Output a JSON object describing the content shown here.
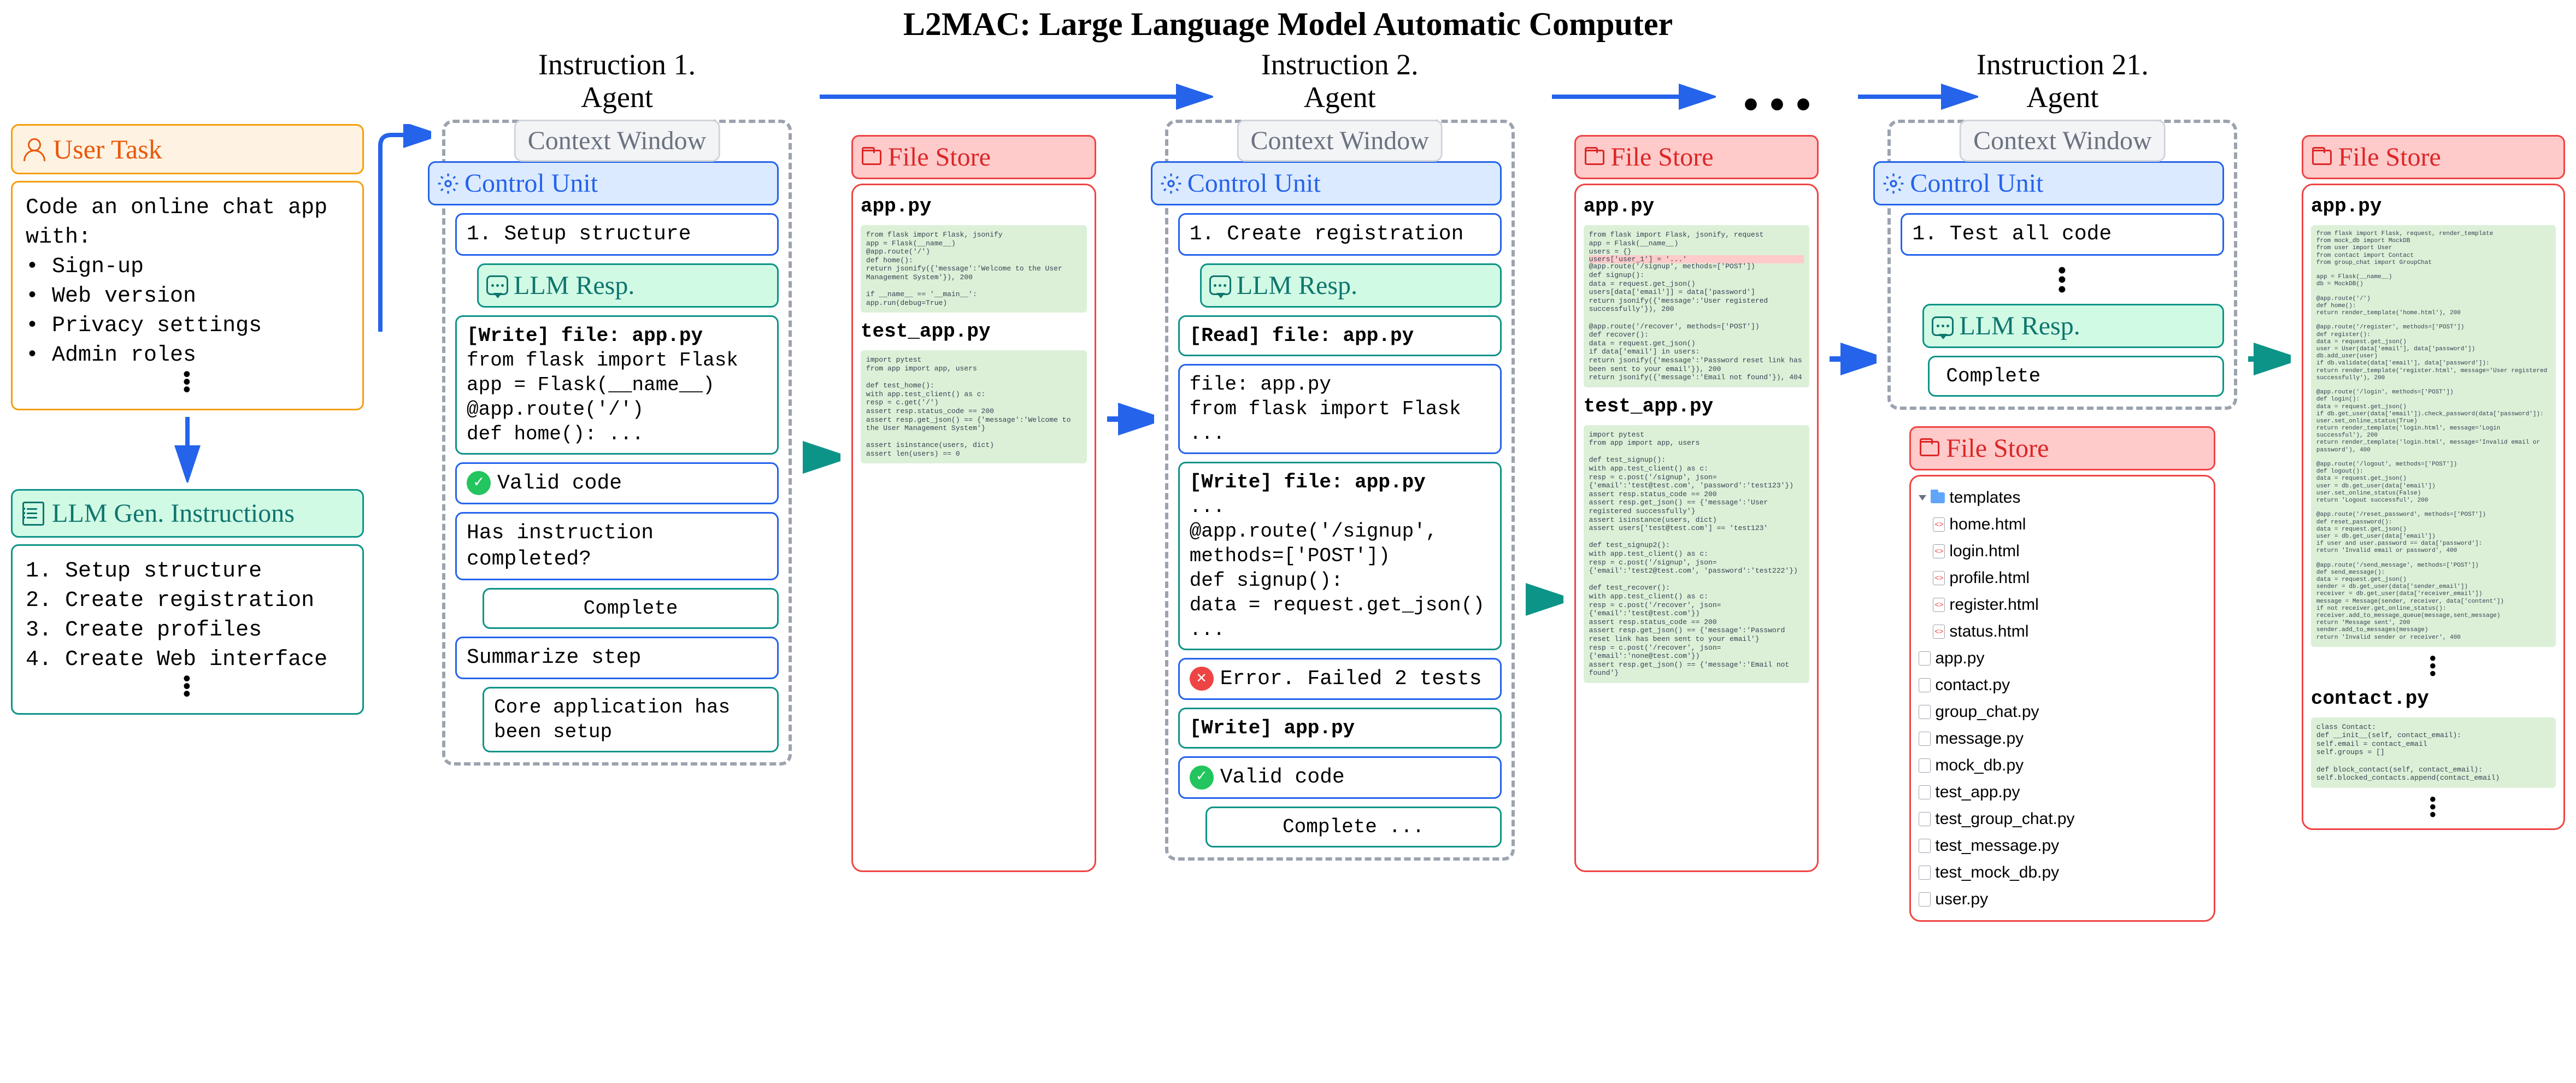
{
  "title": "L2MAC: Large Language Model Automatic Computer",
  "user_task": {
    "header": "User Task",
    "intro": "Code an online chat app with:",
    "bullets": [
      "Sign-up",
      "Web version",
      "Privacy settings",
      "Admin roles"
    ]
  },
  "llm_gen": {
    "header": "LLM Gen. Instructions",
    "items": [
      "1. Setup structure",
      "2. Create registration",
      "3. Create profiles",
      "4. Create Web interface"
    ]
  },
  "labels": {
    "context_window": "Context Window",
    "control_unit": "Control Unit",
    "llm_resp": "LLM Resp.",
    "file_store": "File Store",
    "agent": "Agent"
  },
  "instr1": {
    "title": "Instruction 1.",
    "cu_step": "1. Setup structure",
    "write_header": "[Write] file: app.py",
    "write_body": "from flask import Flask\napp = Flask(__name__)\n@app.route('/')\ndef home(): ...",
    "valid": "Valid code",
    "ask": "Has instruction completed?",
    "complete": "Complete",
    "summarize": "Summarize step",
    "summary": "Core application has been setup",
    "files": {
      "f1": "app.py",
      "c1": "from flask import Flask, jsonify\napp = Flask(__name__)\n@app.route('/')\ndef home():\n    return jsonify({'message':'Welcome to the User Management System'}), 200\n\nif __name__ == '__main__':\n    app.run(debug=True)",
      "f2": "test_app.py",
      "c2": "import pytest\nfrom app import app, users\n\ndef test_home():\n    with app.test_client() as c:\n        resp = c.get('/')\n        assert resp.status_code == 200\n        assert resp.get_json() == {'message':'Welcome to the User Management System'}\n\n    assert isinstance(users, dict)\n    assert len(users) == 0"
    }
  },
  "instr2": {
    "title": "Instruction 2.",
    "cu_step": "1. Create registration",
    "read_header": "[Read] file: app.py",
    "file_echo": "file: app.py\nfrom flask import Flask ...",
    "write_header": "[Write] file: app.py",
    "write_body": "...\n@app.route('/signup', methods=['POST'])\ndef signup():\n    data = request.get_json()\n...",
    "error": "Error. Failed 2 tests",
    "write2": "[Write] app.py",
    "valid": "Valid code",
    "complete": "Complete ...",
    "files": {
      "f1": "app.py",
      "c1_pre": "from flask import Flask, jsonify, request\napp = Flask(__name__)\nusers = {}",
      "c1_diff": "users['user_1'] = '...'",
      "c1_post": "@app.route('/signup', methods=['POST'])\ndef signup():\n    data = request.get_json()\n    users[data['email']] = data['password']\n    return jsonify({'message':'User registered successfully'}), 200\n\n@app.route('/recover', methods=['POST'])\ndef recover():\n    data = request.get_json()\n    if data['email'] in users:\n        return jsonify({'message':'Password reset link has been sent to your email'}), 200\n    return jsonify({'message':'Email not found'}), 404",
      "f2": "test_app.py",
      "c2": "import pytest\nfrom app import app, users\n\ndef test_signup():\n    with app.test_client() as c:\n        resp = c.post('/signup', json={'email':'test@test.com', 'password':'test123'})\n        assert resp.status_code == 200\n        assert resp.get_json() == {'message':'User registered successfully'}\n    assert isinstance(users, dict)\n    assert users['test@test.com'] == 'test123'\n\ndef test_signup2():\n    with app.test_client() as c:\n        resp = c.post('/signup', json={'email':'test2@test.com', 'password':'test222'})\n\ndef test_recover():\n    with app.test_client() as c:\n        resp = c.post('/recover', json={'email':'test@test.com'})\n        assert resp.status_code == 200\n        assert resp.get_json() == {'message':'Password reset link has been sent to your email'}\n        resp = c.post('/recover', json={'email':'none@test.com'})\n        assert resp.get_json() == {'message':'Email not found'}"
    }
  },
  "instr21": {
    "title": "Instruction 21.",
    "cu_step": "1. Test all code",
    "complete": "Complete",
    "tree": {
      "folder": "templates",
      "html": [
        "home.html",
        "login.html",
        "profile.html",
        "register.html",
        "status.html"
      ],
      "py": [
        "app.py",
        "contact.py",
        "group_chat.py",
        "message.py",
        "mock_db.py",
        "test_app.py",
        "test_group_chat.py",
        "test_message.py",
        "test_mock_db.py",
        "user.py"
      ]
    },
    "files": {
      "f1": "app.py",
      "c1": "from flask import Flask, request, render_template\nfrom mock_db import MockDB\nfrom user import User\nfrom contact import Contact\nfrom group_chat import GroupChat\n\napp = Flask(__name__)\ndb = MockDB()\n\n@app.route('/')\ndef home():\n    return render_template('home.html'), 200\n\n@app.route('/register', methods=['POST'])\ndef register():\n    data = request.get_json()\n    user = User(data['email'], data['password'])\n    db.add_user(user)\n    if db.validate(data['email'], data['password']):\n        return render_template('register.html', message='User registered successfully'), 200\n\n@app.route('/login', methods=['POST'])\ndef login():\n    data = request.get_json()\n    if db.get_user(data['email']).check_password(data['password']):\n        user.set_online_status(True)\n        return render_template('login.html', message='Login successful'), 200\n    return render_template('login.html', message='Invalid email or password'), 400\n\n@app.route('/logout', methods=['POST'])\ndef logout():\n    data = request.get_json()\n    user = db.get_user(data['email'])\n    user.set_online_status(False)\n    return 'Logout successful', 200\n\n@app.route('/reset_password', methods=['POST'])\ndef reset_password():\n    data = request.get_json()\n    user = db.get_user(data['email'])\n    if user and user.password == data['password']:\n        return 'Invalid email or password', 400\n\n@app.route('/send_message', methods=['POST'])\ndef send_message():\n    data = request.get_json()\n    sender = db.get_user(data['sender_email'])\n    receiver = db.get_user(data['receiver_email'])\n    message = Message(sender, receiver, data['content'])\n    if not receiver.get_online_status():\n        receiver.add_to_message_queue(message,sent_message)\n    return 'Message sent', 200\n    sender.add_to_messages(message)\n    return 'Invalid sender or receiver', 400",
      "f2": "contact.py",
      "c2": "class Contact:\n    def __init__(self, contact_email):\n        self.email = contact_email\n        self.groups = []\n\ndef block_contact(self, contact_email):\n    self.blocked_contacts.append(contact_email)"
    }
  }
}
